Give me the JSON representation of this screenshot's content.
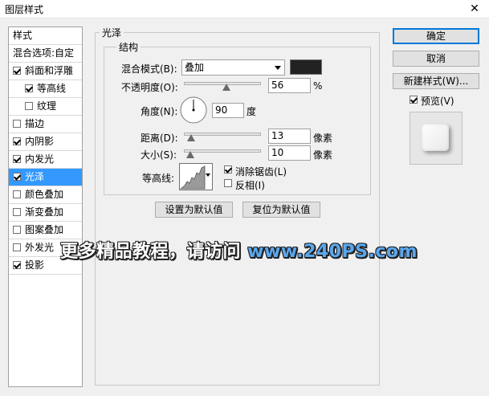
{
  "window": {
    "title": "图层样式",
    "close_glyph": "✕"
  },
  "sidebar": {
    "header": "样式",
    "blend_options": "混合选项:自定",
    "items": [
      {
        "label": "斜面和浮雕",
        "checked": true
      },
      {
        "label": "等高线",
        "checked": true
      },
      {
        "label": "纹理",
        "checked": false
      },
      {
        "label": "描边",
        "checked": false
      },
      {
        "label": "内阴影",
        "checked": true
      },
      {
        "label": "内发光",
        "checked": true
      },
      {
        "label": "光泽",
        "checked": true
      },
      {
        "label": "颜色叠加",
        "checked": false
      },
      {
        "label": "渐变叠加",
        "checked": false
      },
      {
        "label": "图案叠加",
        "checked": false
      },
      {
        "label": "外发光",
        "checked": false
      },
      {
        "label": "投影",
        "checked": true
      }
    ]
  },
  "satin": {
    "group_title": "光泽",
    "structure_title": "结构",
    "blend_mode_label": "混合模式(B):",
    "blend_mode_value": "叠加",
    "blend_color": "#222222",
    "opacity_label": "不透明度(O):",
    "opacity_value": "56",
    "opacity_unit": "%",
    "angle_label": "角度(N):",
    "angle_value": "90",
    "angle_unit": "度",
    "distance_label": "距离(D):",
    "distance_value": "13",
    "distance_unit": "像素",
    "size_label": "大小(S):",
    "size_value": "10",
    "size_unit": "像素",
    "contour_label": "等高线:",
    "antialias_label": "消除锯齿(L)",
    "antialias_checked": true,
    "invert_label": "反相(I)",
    "invert_checked": false,
    "reset_default_set": "设置为默认值",
    "reset_default_restore": "复位为默认值"
  },
  "right": {
    "ok": "确定",
    "cancel": "取消",
    "new_style": "新建样式(W)...",
    "preview_label": "预览(V)",
    "preview_checked": true
  },
  "watermark": {
    "text": "更多精品教程，请访问 ",
    "url": "www.240PS.com"
  }
}
